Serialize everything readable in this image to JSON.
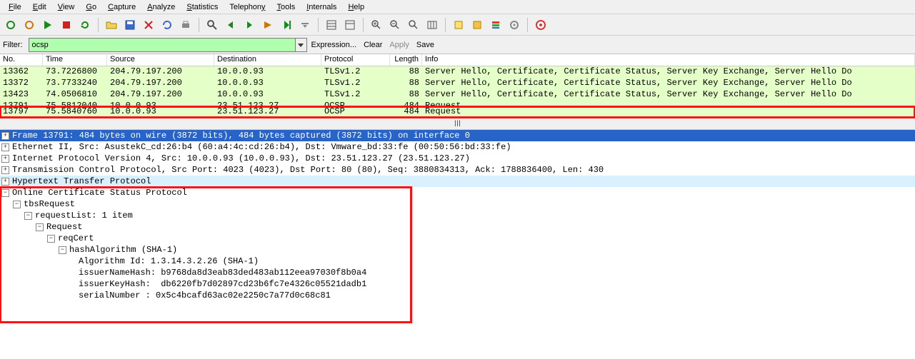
{
  "menu": [
    "File",
    "Edit",
    "View",
    "Go",
    "Capture",
    "Analyze",
    "Statistics",
    "Telephony",
    "Tools",
    "Internals",
    "Help"
  ],
  "filter": {
    "label": "Filter:",
    "value": "ocsp",
    "expression": "Expression...",
    "clear": "Clear",
    "apply": "Apply",
    "save": "Save"
  },
  "columns": {
    "no": "No.",
    "time": "Time",
    "src": "Source",
    "dst": "Destination",
    "proto": "Protocol",
    "len": "Length",
    "info": "Info"
  },
  "packets": [
    {
      "no": "13362",
      "time": "73.7226800",
      "src": "204.79.197.200",
      "dst": "10.0.0.93",
      "proto": "TLSv1.2",
      "len": "88",
      "info": "Server Hello, Certificate, Certificate Status, Server Key Exchange, Server Hello Do"
    },
    {
      "no": "13372",
      "time": "73.7733240",
      "src": "204.79.197.200",
      "dst": "10.0.0.93",
      "proto": "TLSv1.2",
      "len": "88",
      "info": "Server Hello, Certificate, Certificate Status, Server Key Exchange, Server Hello Do"
    },
    {
      "no": "13423",
      "time": "74.0506810",
      "src": "204.79.197.200",
      "dst": "10.0.0.93",
      "proto": "TLSv1.2",
      "len": "88",
      "info": "Server Hello, Certificate, Certificate Status, Server Key Exchange, Server Hello Do"
    },
    {
      "no": "13791",
      "time": "75.5812040",
      "src": "10.0.0.93",
      "dst": "23.51.123.27",
      "proto": "OCSP",
      "len": "484",
      "info": "Request"
    },
    {
      "no": "13797",
      "time": "75.5840760",
      "src": "10.0.0.93",
      "dst": "23.51.123.27",
      "proto": "OCSP",
      "len": "484",
      "info": "Request"
    }
  ],
  "details": {
    "frame": "Frame 13791: 484 bytes on wire (3872 bits), 484 bytes captured (3872 bits) on interface 0",
    "eth": "Ethernet II, Src: AsustekC_cd:26:b4 (60:a4:4c:cd:26:b4), Dst: Vmware_bd:33:fe (00:50:56:bd:33:fe)",
    "ip": "Internet Protocol Version 4, Src: 10.0.0.93 (10.0.0.93), Dst: 23.51.123.27 (23.51.123.27)",
    "tcp": "Transmission Control Protocol, Src Port: 4023 (4023), Dst Port: 80 (80), Seq: 3880834313, Ack: 1788836400, Len: 430",
    "http": "Hypertext Transfer Protocol",
    "ocsp": {
      "title": "Online Certificate Status Protocol",
      "tbsRequest": "tbsRequest",
      "requestList": "requestList: 1 item",
      "request": "Request",
      "reqCert": "reqCert",
      "hashAlgorithm": "hashAlgorithm (SHA-1)",
      "algorithmId": "Algorithm Id: 1.3.14.3.2.26 (SHA-1)",
      "issuerNameHash": "issuerNameHash: b9768da8d3eab83ded483ab112eea97030f8b0a4",
      "issuerKeyHash": "issuerKeyHash:  db6220fb7d02897cd23b6fc7e4326c05521dadb1",
      "serialNumber": "serialNumber : 0x5c4bcafd63ac02e2250c7a77d0c68c81"
    }
  },
  "scroll_indicator": "⟨━━━━━━━━━━━━━━━━━━━━━━━━━━━━━━━━━━━━━━━━━━━━━━━━━━━━━━━━━━━━━━━━━━━━━━━━⟩"
}
